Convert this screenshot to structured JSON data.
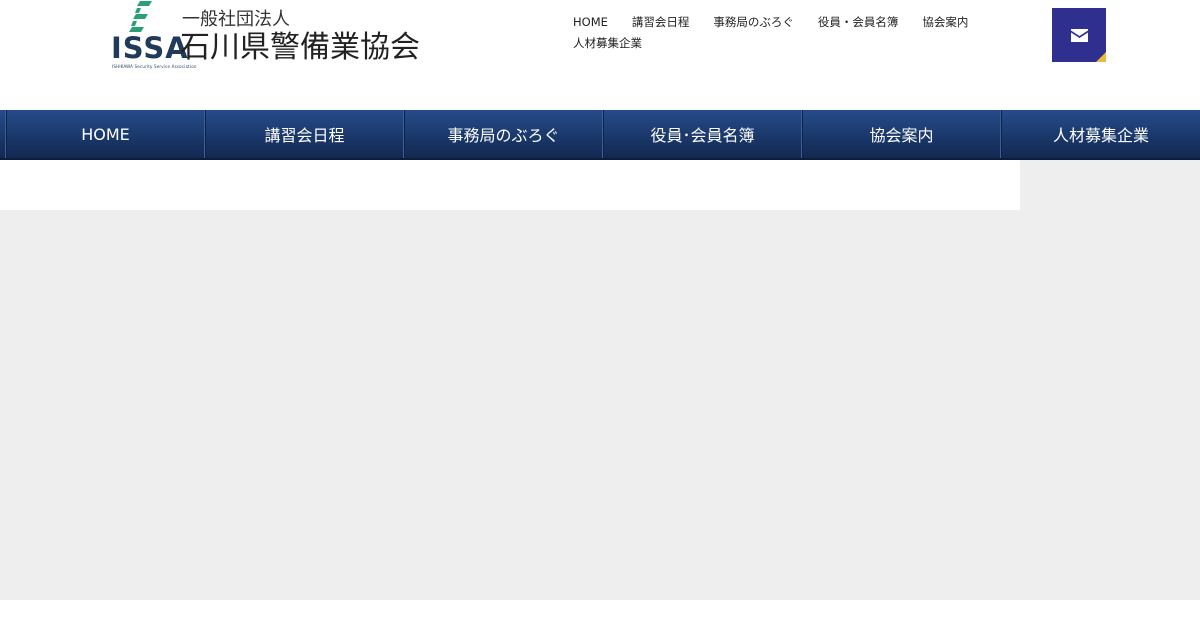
{
  "logo": {
    "issa": "ISSA",
    "tagline": "ISHIKAWA Security Service Association",
    "sub": "一般社団法人",
    "main": "石川県警備業協会"
  },
  "top_links": [
    "HOME",
    "講習会日程",
    "事務局のぶろぐ",
    "役員・会員名簿",
    "協会案内",
    "人材募集企業"
  ],
  "nav": [
    "HOME",
    "講習会日程",
    "事務局のぶろぐ",
    "役員･会員名簿",
    "協会案内",
    "人材募集企業"
  ],
  "colors": {
    "nav_top": "#274c8a",
    "nav_bottom": "#12284f",
    "mail_button": "#2f2f8f",
    "mail_corner": "#e9b93a",
    "logo_green": "#2aa07a",
    "logo_navy": "#1f3a5a",
    "content_bg": "#eeeeee"
  },
  "icons": {
    "mail": "envelope-icon"
  }
}
